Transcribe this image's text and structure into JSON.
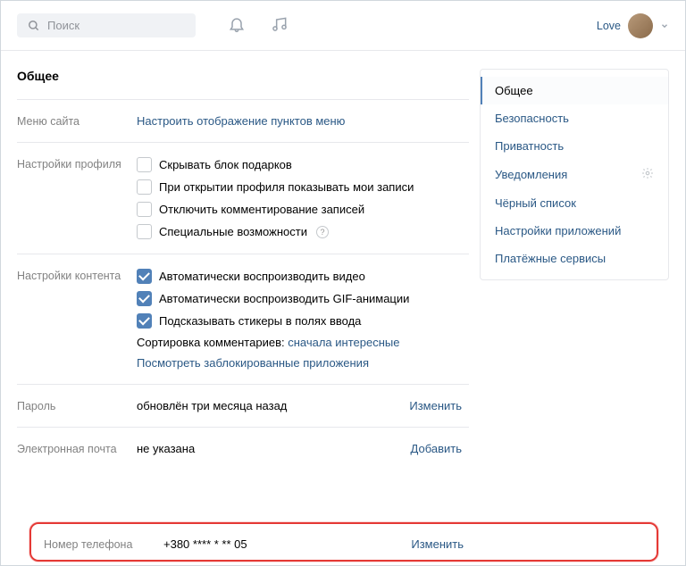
{
  "header": {
    "search_placeholder": "Поиск",
    "user_name": "Love"
  },
  "page_title": "Общее",
  "rows": {
    "site_menu": {
      "label": "Меню сайта",
      "link": "Настроить отображение пунктов меню"
    },
    "profile": {
      "label": "Настройки профиля",
      "opts": [
        "Скрывать блок подарков",
        "При открытии профиля показывать мои записи",
        "Отключить комментирование записей",
        "Специальные возможности"
      ]
    },
    "content": {
      "label": "Настройки контента",
      "opts": [
        "Автоматически воспроизводить видео",
        "Автоматически воспроизводить GIF-анимации",
        "Подсказывать стикеры в полях ввода"
      ],
      "sort_label": "Сортировка комментариев: ",
      "sort_value": "сначала интересные",
      "blocked_link": "Посмотреть заблокированные приложения"
    },
    "password": {
      "label": "Пароль",
      "value": "обновлён три месяца назад",
      "action": "Изменить"
    },
    "email": {
      "label": "Электронная почта",
      "value": "не указана",
      "action": "Добавить"
    },
    "phone": {
      "label": "Номер телефона",
      "value": "+380 **** * ** 05",
      "action": "Изменить"
    }
  },
  "sidebar": [
    "Общее",
    "Безопасность",
    "Приватность",
    "Уведомления",
    "Чёрный список",
    "Настройки приложений",
    "Платёжные сервисы"
  ]
}
